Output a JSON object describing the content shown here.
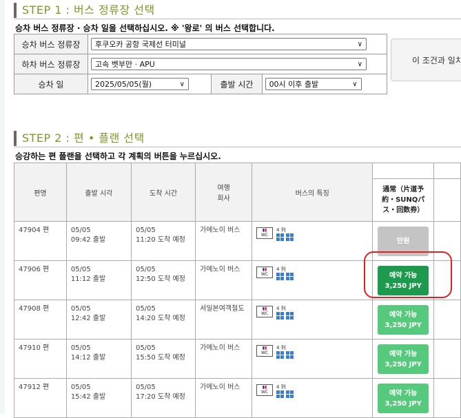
{
  "step1": {
    "heading": "STEP 1 : 버스 정류장 선택",
    "instruction": "승차 버스 정류장 · 승차 일을 선택하십시오. ※ '왕로' 의 버스 선택합니다.",
    "board_stop_label": "승차 버스 정류장",
    "board_stop_value": "후쿠오카 공항 국제선 터미널",
    "alight_stop_label": "하차 버스 정류장",
    "alight_stop_value": "고속 벳부만 · APU",
    "date_label": "승차 일",
    "date_value": "2025/05/05(월)",
    "departure_time_label": "출발 시간",
    "departure_time_value": "00시 이후 출발",
    "search_button": "이 조건과 일치"
  },
  "step2": {
    "heading": "STEP 2 : 편 • 플랜 선택",
    "instruction": "승강하는 편 플랜을 선택하고 각 계획의 버튼을 누르십시오.",
    "columns": {
      "trip": "편명",
      "departure": "출발 시각",
      "arrival": "도착 시간",
      "operator_line1": "여행",
      "operator_line2": "회사",
      "features": "버스의 특징",
      "plan": "通常（片道予約・SUNQパス・回数券）"
    },
    "seat_label": "4 列",
    "rows": [
      {
        "trip": "47904 편",
        "dep_date": "05/05",
        "dep_time": "09:42 출발",
        "arr_date": "05/05",
        "arr_time": "11:20 도착 예정",
        "operator": "가메노이 버스",
        "button_line1": "만원",
        "button_line2": "",
        "status": "full"
      },
      {
        "trip": "47906 편",
        "dep_date": "05/05",
        "dep_time": "11:12 출발",
        "arr_date": "05/05",
        "arr_time": "12:50 도착 예정",
        "operator": "가메노이 버스",
        "button_line1": "예약 가능",
        "button_line2": "3,250 JPY",
        "status": "available-highlighted"
      },
      {
        "trip": "47908 편",
        "dep_date": "05/05",
        "dep_time": "12:42 출발",
        "arr_date": "05/05",
        "arr_time": "14:20 도착 예정",
        "operator": "서일본여객철도",
        "button_line1": "예약 가능",
        "button_line2": "3,250 JPY",
        "status": "available"
      },
      {
        "trip": "47910 편",
        "dep_date": "05/05",
        "dep_time": "14:12 출발",
        "arr_date": "05/05",
        "arr_time": "15:50 도착 예정",
        "operator": "가메노이 버스",
        "button_line1": "예약 가능",
        "button_line2": "3,250 JPY",
        "status": "available"
      },
      {
        "trip": "47912 편",
        "dep_date": "05/05",
        "dep_time": "15:42 출발",
        "arr_date": "05/05",
        "arr_time": "17:20 도착 예정",
        "operator": "가메노이 버스",
        "button_line1": "예약 가능",
        "button_line2": "3,250 JPY",
        "status": "available"
      }
    ]
  },
  "colors": {
    "heading_green": "#7c9a2a",
    "available_button": "#56c97c",
    "selected_button": "#1e9a4e",
    "full_button": "#c4c4c4",
    "annotation_red": "#e02020"
  }
}
